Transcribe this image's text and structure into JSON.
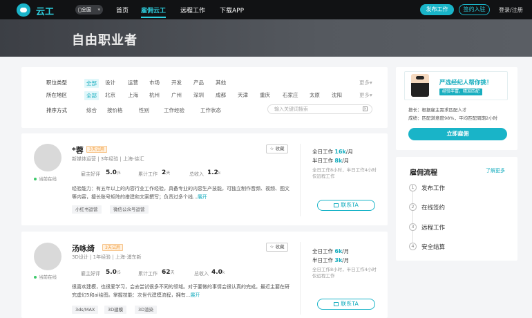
{
  "topbar": {
    "logo_text": "云工",
    "location": "全国",
    "nav": [
      "首页",
      "雇佣云工",
      "远程工作",
      "下载APP"
    ],
    "post_btn": "发布工作",
    "join_btn": "签约入驻",
    "login": "登录/注册"
  },
  "hero": {
    "title": "自由职业者"
  },
  "filters": {
    "job_type": {
      "label": "职位类型",
      "options": [
        "全部",
        "设计",
        "运营",
        "市场",
        "开发",
        "产品",
        "其他"
      ],
      "more": "更多"
    },
    "region": {
      "label": "所在地区",
      "options": [
        "全部",
        "北京",
        "上海",
        "杭州",
        "广州",
        "深圳",
        "成都",
        "天津",
        "重庆",
        "石家庄",
        "太原",
        "沈阳"
      ],
      "more": "更多"
    },
    "sort": {
      "label": "排序方式",
      "options": [
        "综合",
        "按价格",
        "性别",
        "工作经验",
        "工作状态"
      ]
    },
    "search_placeholder": "输入关键词搜索"
  },
  "freelancers": [
    {
      "name": "*蓉",
      "badge": "3天试用",
      "status": "当前在线",
      "meta": "新媒体运营 | 3年经验 | 上海-徐汇",
      "rating_label": "雇主好评",
      "rating": "5.0",
      "rating_unit": "/5",
      "days_label": "累计工作",
      "days": "2",
      "days_unit": "天",
      "income_label": "总收入",
      "income": "1.2",
      "income_unit": "k",
      "description": "经验能力：有五年以上的内容行业工作经验，具备专业的内容生产技能，可独立制作音频、视频、图文等内容，擅长账号矩阵的搭建和文案撰写；负责过多个线...",
      "expand": "展开",
      "tags": [
        "小红书运营",
        "微信公众号运营"
      ],
      "fav": "收藏",
      "full_label": "全日工作",
      "full_rate": "16k",
      "full_unit": "/月",
      "half_label": "半日工作",
      "half_rate": "8k",
      "half_unit": "/月",
      "note": "全日工作8小时，半日工作4小时仅远程工作",
      "contact": "联系TA"
    },
    {
      "name": "汤咏绮",
      "badge": "3天试用",
      "status": "当前在线",
      "meta": "3D设计 | 1年经验 | 上海-浦东新",
      "rating_label": "雇主好评",
      "rating": "5.0",
      "rating_unit": "/5",
      "days_label": "累计工作",
      "days": "62",
      "days_unit": "天",
      "income_label": "总收入",
      "income": "4.0",
      "income_unit": "k",
      "description": "很喜欢建模，也很爱学习，会去尝试很多不同的领域。对于要做的事情会很认真的完成。最近主要在研究虚幻5和ai绘图。掌握技能：次世代建模流程，拥有...",
      "expand": "展开",
      "tags": [
        "3ds/MAX",
        "3D建模",
        "3D渲染"
      ],
      "fav": "收藏",
      "full_label": "全日工作",
      "full_rate": "6k",
      "full_unit": "/月",
      "half_label": "半日工作",
      "half_rate": "3k",
      "half_unit": "/月",
      "note": "全日工作8小时，半日工作4小时仅远程工作",
      "contact": "联系TA"
    }
  ],
  "sidebar": {
    "ad_title": "严选经纪人帮你挑！",
    "ad_sub": "经验丰富，精准匹配",
    "info1": "擅长：根据雇主需求匹配人才",
    "info2": "成绩：匹配满意度98%，平均匹配周期2小时",
    "hire_btn": "立即雇佣",
    "flow_title": "雇佣流程",
    "flow_more": "了解更多",
    "steps": [
      "发布工作",
      "在线签约",
      "远程工作",
      "安全结算"
    ]
  },
  "colors": {
    "accent": "#19b4c8",
    "badge": "#f39c38",
    "online": "#3ec96b"
  }
}
